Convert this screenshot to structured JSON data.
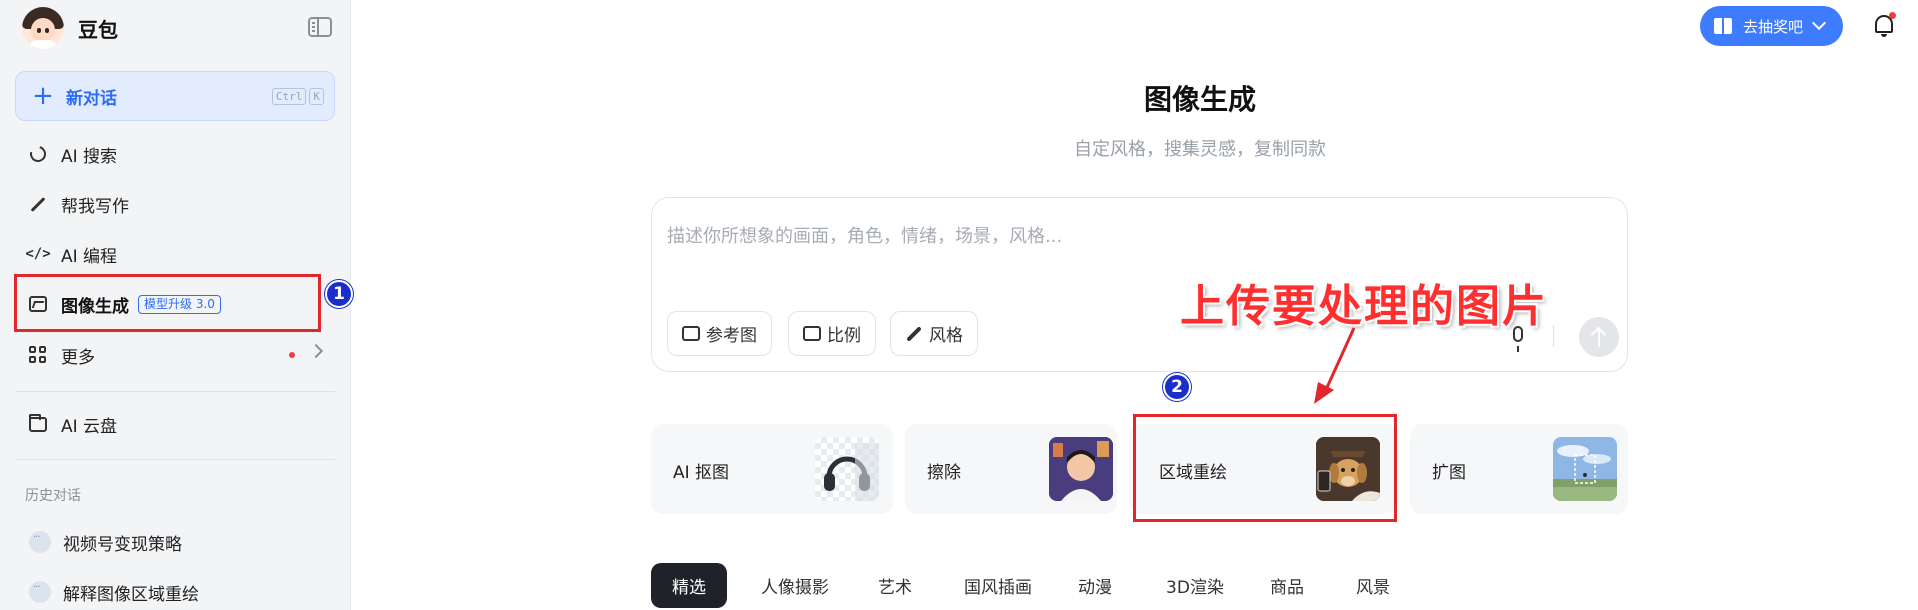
{
  "sidebar": {
    "brand_name": "豆包",
    "new_chat": {
      "label": "新对话",
      "shortcut_keys": [
        "Ctrl",
        "K"
      ]
    },
    "nav_items": [
      {
        "label": "AI 搜索",
        "icon": "search-icon"
      },
      {
        "label": "帮我写作",
        "icon": "pen-icon"
      },
      {
        "label": "AI 编程",
        "icon": "code-icon"
      },
      {
        "label": "图像生成",
        "icon": "image-icon",
        "badge": "模型升级 3.0",
        "active": true
      },
      {
        "label": "更多",
        "icon": "grid-icon",
        "has_notification": true
      }
    ],
    "cloud": {
      "label": "AI 云盘",
      "icon": "cloud-folder-icon"
    },
    "history_title": "历史对话",
    "history": [
      {
        "label": "视频号变现策略"
      },
      {
        "label": "解释图像区域重绘"
      }
    ]
  },
  "header": {
    "lottery_button": "去抽奖吧",
    "accent_color": "#3d7bff"
  },
  "main": {
    "title": "图像生成",
    "subtitle": "自定风格，搜集灵感，复制同款",
    "composer": {
      "placeholder": "描述你所想象的画面，角色，情绪，场景，风格...",
      "tools": [
        "参考图",
        "比例",
        "风格"
      ]
    },
    "quick_cards": [
      {
        "label": "AI 抠图",
        "thumb": "headphones-thumbnail"
      },
      {
        "label": "擦除",
        "thumb": "child-portrait-thumbnail"
      },
      {
        "label": "区域重绘",
        "thumb": "dog-thumbnail"
      },
      {
        "label": "扩图",
        "thumb": "landscape-thumbnail"
      }
    ],
    "categories": [
      "精选",
      "人像摄影",
      "艺术",
      "国风插画",
      "动漫",
      "3D渲染",
      "商品",
      "风景"
    ],
    "active_category": "精选"
  },
  "annotations": {
    "step1": "1",
    "step2": "2",
    "callout_text": "上传要处理的图片",
    "annotation_color": "#e3262b"
  }
}
